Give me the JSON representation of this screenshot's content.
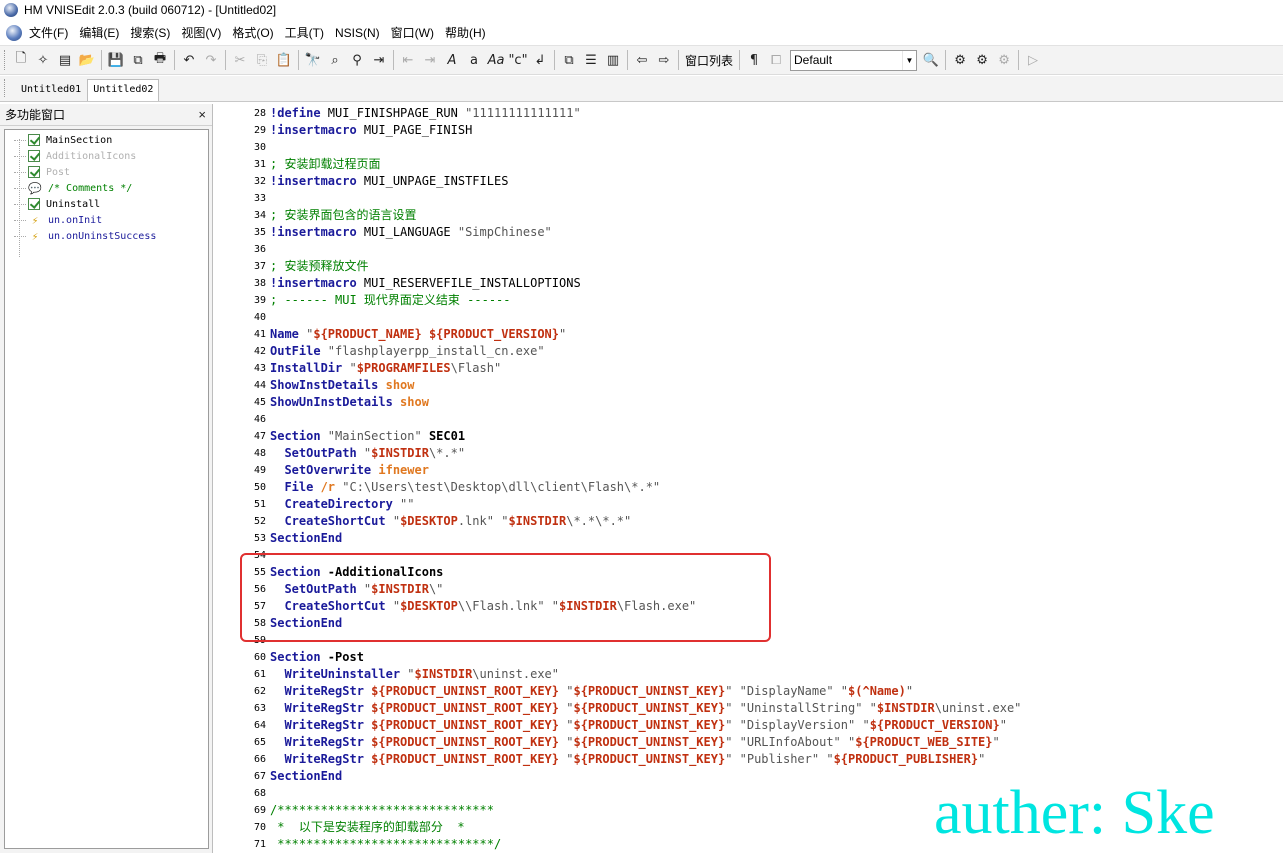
{
  "window": {
    "title": "HM VNISEdit 2.0.3 (build 060712) - [Untitled02]"
  },
  "menubar": {
    "items": [
      "文件(F)",
      "编辑(E)",
      "搜索(S)",
      "视图(V)",
      "格式(O)",
      "工具(T)",
      "NSIS(N)",
      "窗口(W)",
      "帮助(H)"
    ]
  },
  "toolbar": {
    "window_list_label": "窗口列表",
    "style_combo_value": "Default"
  },
  "tabs": [
    {
      "label": "Untitled01",
      "active": false
    },
    {
      "label": "Untitled02",
      "active": true
    }
  ],
  "sidebar": {
    "title": "多功能窗口",
    "close": "×",
    "items": [
      {
        "label": "MainSection",
        "icon": "checkbox-checked-icon",
        "color": "#000000"
      },
      {
        "label": "AdditionalIcons",
        "icon": "checkbox-checked-icon",
        "color": "#b0b0b0"
      },
      {
        "label": "Post",
        "icon": "checkbox-checked-icon",
        "color": "#b0b0b0"
      },
      {
        "label": "/* Comments */",
        "icon": "comment-icon",
        "color": "#008000"
      },
      {
        "label": "Uninstall",
        "icon": "checkbox-checked-icon",
        "color": "#000000"
      },
      {
        "label": "un.onInit",
        "icon": "function-icon",
        "color": "#1a1a9a"
      },
      {
        "label": "un.onUninstSuccess",
        "icon": "function-icon",
        "color": "#1a1a9a"
      }
    ]
  },
  "editor": {
    "lines": [
      {
        "n": "28",
        "t": [
          [
            "k",
            "!define"
          ],
          [
            "",
            "MUI_FINISHPAGE_RUN "
          ],
          [
            "s",
            "\"11111111111111\""
          ]
        ]
      },
      {
        "n": "29",
        "t": [
          [
            "k",
            "!insertmacro"
          ],
          [
            "",
            "MUI_PAGE_FINISH"
          ]
        ]
      },
      {
        "n": "30",
        "t": []
      },
      {
        "n": "31",
        "t": [
          [
            "c",
            "; 安装卸载过程页面"
          ]
        ]
      },
      {
        "n": "32",
        "t": [
          [
            "k",
            "!insertmacro"
          ],
          [
            "",
            "MUI_UNPAGE_INSTFILES"
          ]
        ]
      },
      {
        "n": "33",
        "t": []
      },
      {
        "n": "34",
        "t": [
          [
            "c",
            "; 安装界面包含的语言设置"
          ]
        ]
      },
      {
        "n": "35",
        "t": [
          [
            "k",
            "!insertmacro"
          ],
          [
            "",
            "MUI_LANGUAGE "
          ],
          [
            "s",
            "\"SimpChinese\""
          ]
        ]
      },
      {
        "n": "36",
        "t": []
      },
      {
        "n": "37",
        "t": [
          [
            "c",
            "; 安装预释放文件"
          ]
        ]
      },
      {
        "n": "38",
        "t": [
          [
            "k",
            "!insertmacro"
          ],
          [
            "",
            "MUI_RESERVEFILE_INSTALLOPTIONS"
          ]
        ]
      },
      {
        "n": "39",
        "t": [
          [
            "c",
            "; ------ MUI 现代界面定义结束 ------"
          ]
        ]
      },
      {
        "n": "40",
        "t": []
      },
      {
        "n": "41",
        "t": [
          [
            "k",
            "Name"
          ],
          [
            "s",
            " \""
          ],
          [
            "v",
            "${PRODUCT_NAME} ${PRODUCT_VERSION}"
          ],
          [
            "s",
            "\""
          ]
        ]
      },
      {
        "n": "42",
        "t": [
          [
            "k",
            "OutFile"
          ],
          [
            "s",
            " \"flashplayerpp_install_cn.exe\""
          ]
        ]
      },
      {
        "n": "43",
        "t": [
          [
            "k",
            "InstallDir"
          ],
          [
            "s",
            " \""
          ],
          [
            "v",
            "$PROGRAMFILES"
          ],
          [
            "s",
            "\\Flash\""
          ]
        ]
      },
      {
        "n": "44",
        "t": [
          [
            "k",
            "ShowInstDetails"
          ],
          [
            "o",
            " show"
          ]
        ]
      },
      {
        "n": "45",
        "t": [
          [
            "k",
            "ShowUnInstDetails"
          ],
          [
            "o",
            " show"
          ]
        ]
      },
      {
        "n": "46",
        "t": []
      },
      {
        "n": "47",
        "t": [
          [
            "k",
            "Section"
          ],
          [
            "s",
            " \"MainSection\""
          ],
          [
            "b",
            " SEC01"
          ]
        ]
      },
      {
        "n": "48",
        "t": [
          [
            "",
            "  "
          ],
          [
            "k",
            "SetOutPath"
          ],
          [
            "s",
            " \""
          ],
          [
            "v",
            "$INSTDIR"
          ],
          [
            "s",
            "\\*.*\""
          ]
        ]
      },
      {
        "n": "49",
        "t": [
          [
            "",
            "  "
          ],
          [
            "k",
            "SetOverwrite"
          ],
          [
            "o",
            " ifnewer"
          ]
        ]
      },
      {
        "n": "50",
        "t": [
          [
            "",
            "  "
          ],
          [
            "k",
            "File"
          ],
          [
            "o",
            " /r"
          ],
          [
            "s",
            " \"C:\\Users\\test\\Desktop\\dll\\client\\Flash\\*.*\""
          ]
        ]
      },
      {
        "n": "51",
        "t": [
          [
            "",
            "  "
          ],
          [
            "k",
            "CreateDirectory"
          ],
          [
            "s",
            " \"\""
          ]
        ]
      },
      {
        "n": "52",
        "t": [
          [
            "",
            "  "
          ],
          [
            "k",
            "CreateShortCut"
          ],
          [
            "s",
            " \""
          ],
          [
            "v",
            "$DESKTOP"
          ],
          [
            "s",
            ".lnk\" \""
          ],
          [
            "v",
            "$INSTDIR"
          ],
          [
            "s",
            "\\*.*\\*.*\""
          ]
        ]
      },
      {
        "n": "53",
        "t": [
          [
            "k",
            "SectionEnd"
          ]
        ]
      },
      {
        "n": "54",
        "t": []
      },
      {
        "n": "55",
        "t": [
          [
            "k",
            "Section"
          ],
          [
            "b",
            " -AdditionalIcons"
          ]
        ]
      },
      {
        "n": "56",
        "t": [
          [
            "",
            "  "
          ],
          [
            "k",
            "SetOutPath"
          ],
          [
            "s",
            " \""
          ],
          [
            "v",
            "$INSTDIR"
          ],
          [
            "s",
            "\\\""
          ]
        ]
      },
      {
        "n": "57",
        "t": [
          [
            "",
            "  "
          ],
          [
            "k",
            "CreateShortCut"
          ],
          [
            "s",
            " \""
          ],
          [
            "v",
            "$DESKTOP"
          ],
          [
            "s",
            "\\\\Flash.lnk\" \""
          ],
          [
            "v",
            "$INSTDIR"
          ],
          [
            "s",
            "\\Flash.exe\""
          ]
        ]
      },
      {
        "n": "58",
        "t": [
          [
            "k",
            "SectionEnd"
          ]
        ]
      },
      {
        "n": "59",
        "t": []
      },
      {
        "n": "60",
        "t": [
          [
            "k",
            "Section"
          ],
          [
            "b",
            " -Post"
          ]
        ]
      },
      {
        "n": "61",
        "t": [
          [
            "",
            "  "
          ],
          [
            "k",
            "WriteUninstaller"
          ],
          [
            "s",
            " \""
          ],
          [
            "v",
            "$INSTDIR"
          ],
          [
            "s",
            "\\uninst.exe\""
          ]
        ]
      },
      {
        "n": "62",
        "t": [
          [
            "",
            "  "
          ],
          [
            "k",
            "WriteRegStr"
          ],
          [
            "v",
            " ${PRODUCT_UNINST_ROOT_KEY}"
          ],
          [
            "s",
            " \""
          ],
          [
            "v",
            "${PRODUCT_UNINST_KEY}"
          ],
          [
            "s",
            "\" \"DisplayName\" \""
          ],
          [
            "v",
            "$(^Name)"
          ],
          [
            "s",
            "\""
          ]
        ]
      },
      {
        "n": "63",
        "t": [
          [
            "",
            "  "
          ],
          [
            "k",
            "WriteRegStr"
          ],
          [
            "v",
            " ${PRODUCT_UNINST_ROOT_KEY}"
          ],
          [
            "s",
            " \""
          ],
          [
            "v",
            "${PRODUCT_UNINST_KEY}"
          ],
          [
            "s",
            "\" \"UninstallString\" \""
          ],
          [
            "v",
            "$INSTDIR"
          ],
          [
            "s",
            "\\uninst.exe\""
          ]
        ]
      },
      {
        "n": "64",
        "t": [
          [
            "",
            "  "
          ],
          [
            "k",
            "WriteRegStr"
          ],
          [
            "v",
            " ${PRODUCT_UNINST_ROOT_KEY}"
          ],
          [
            "s",
            " \""
          ],
          [
            "v",
            "${PRODUCT_UNINST_KEY}"
          ],
          [
            "s",
            "\" \"DisplayVersion\" \""
          ],
          [
            "v",
            "${PRODUCT_VERSION}"
          ],
          [
            "s",
            "\""
          ]
        ]
      },
      {
        "n": "65",
        "t": [
          [
            "",
            "  "
          ],
          [
            "k",
            "WriteRegStr"
          ],
          [
            "v",
            " ${PRODUCT_UNINST_ROOT_KEY}"
          ],
          [
            "s",
            " \""
          ],
          [
            "v",
            "${PRODUCT_UNINST_KEY}"
          ],
          [
            "s",
            "\" \"URLInfoAbout\" \""
          ],
          [
            "v",
            "${PRODUCT_WEB_SITE}"
          ],
          [
            "s",
            "\""
          ]
        ]
      },
      {
        "n": "66",
        "t": [
          [
            "",
            "  "
          ],
          [
            "k",
            "WriteRegStr"
          ],
          [
            "v",
            " ${PRODUCT_UNINST_ROOT_KEY}"
          ],
          [
            "s",
            " \""
          ],
          [
            "v",
            "${PRODUCT_UNINST_KEY}"
          ],
          [
            "s",
            "\" \"Publisher\" \""
          ],
          [
            "v",
            "${PRODUCT_PUBLISHER}"
          ],
          [
            "s",
            "\""
          ]
        ]
      },
      {
        "n": "67",
        "t": [
          [
            "k",
            "SectionEnd"
          ]
        ]
      },
      {
        "n": "68",
        "t": []
      },
      {
        "n": "69",
        "t": [
          [
            "c",
            "/******************************"
          ]
        ]
      },
      {
        "n": "70",
        "t": [
          [
            "c",
            " *  以下是安装程序的卸载部分  *"
          ]
        ]
      },
      {
        "n": "71",
        "t": [
          [
            "c",
            " ******************************/"
          ]
        ]
      }
    ]
  },
  "watermark": "auther: Ske",
  "colors": {
    "keyword": "#1a1a9a",
    "variable": "#c03010",
    "comment": "#008000",
    "option": "#e07820",
    "highlight_box": "#e03030",
    "watermark": "#00e5e0"
  }
}
